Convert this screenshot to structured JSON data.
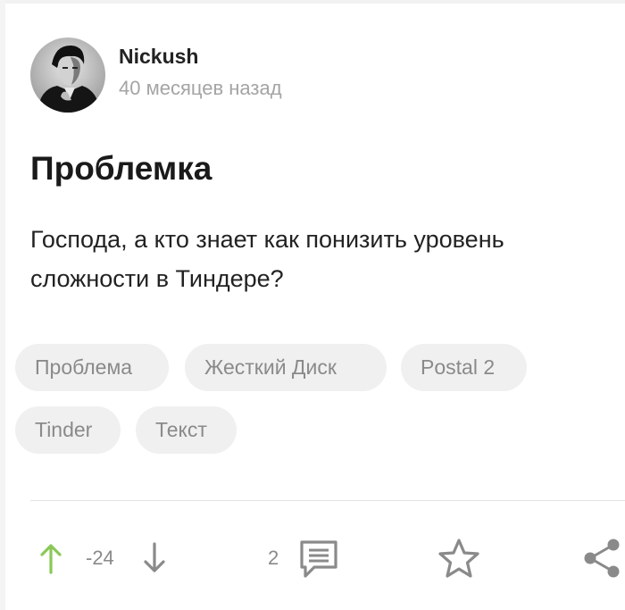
{
  "post": {
    "author": {
      "name": "Nickush",
      "posted_ago": "40 месяцев назад",
      "avatar_icon": "author-avatar-photo"
    },
    "title": "Проблемка",
    "body_lines": [
      "Господа, а кто знает как понизить уровень",
      "сложности в Тиндере?"
    ],
    "tags": [
      "Проблема",
      "Жесткий Диск",
      "Postal 2",
      "Tinder",
      "Текст"
    ],
    "actions": {
      "rating": "-24",
      "comments_count": "2",
      "icons": [
        "upvote-arrow-icon",
        "downvote-arrow-icon",
        "comment-icon",
        "star-icon",
        "share-icon"
      ]
    }
  },
  "colors": {
    "upvote_green": "#8ac858",
    "icon_gray": "#8a8a8a",
    "tag_bg": "#f0f0f0",
    "meta_gray": "#a4a4a4"
  }
}
